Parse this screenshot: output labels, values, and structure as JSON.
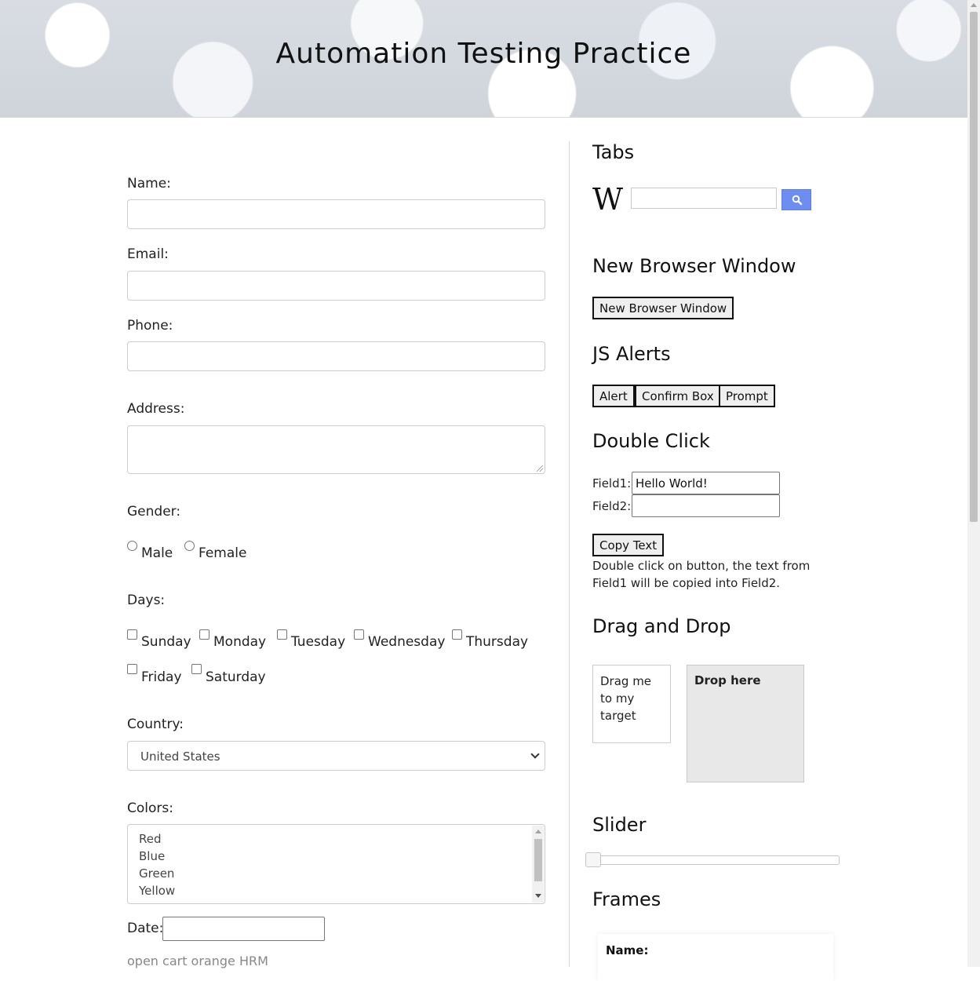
{
  "header": {
    "title": "Automation Testing Practice"
  },
  "form": {
    "name_label": "Name:",
    "email_label": "Email:",
    "phone_label": "Phone:",
    "address_label": "Address:",
    "gender_label": "Gender:",
    "gender_options": [
      "Male",
      "Female"
    ],
    "days_label": "Days:",
    "days": [
      "Sunday",
      "Monday",
      "Tuesday",
      "Wednesday",
      "Thursday",
      "Friday",
      "Saturday"
    ],
    "country_label": "Country:",
    "country_value": "United States",
    "colors_label": "Colors:",
    "colors_options": [
      "Red",
      "Blue",
      "Green",
      "Yellow"
    ],
    "date_label": "Date:",
    "links_text": "open cart orange HRM"
  },
  "tabs": {
    "heading": "Tabs"
  },
  "new_window": {
    "heading": "New Browser Window",
    "button": "New Browser Window"
  },
  "alerts": {
    "heading": "JS Alerts",
    "alert": "Alert",
    "confirm": "Confirm Box",
    "prompt": "Prompt"
  },
  "double_click": {
    "heading": "Double Click",
    "field1_label": "Field1:",
    "field1_value": "Hello World!",
    "field2_label": "Field2:",
    "button": "Copy Text",
    "note": "Double click on button, the text from Field1 will be copied into Field2."
  },
  "drag_drop": {
    "heading": "Drag and Drop",
    "drag_text": "Drag me to my target",
    "drop_text": "Drop here"
  },
  "slider": {
    "heading": "Slider",
    "value_fraction": 0
  },
  "frames": {
    "heading": "Frames",
    "name_label": "Name:"
  },
  "colors": {
    "wiki_button": "#6d8df0"
  }
}
